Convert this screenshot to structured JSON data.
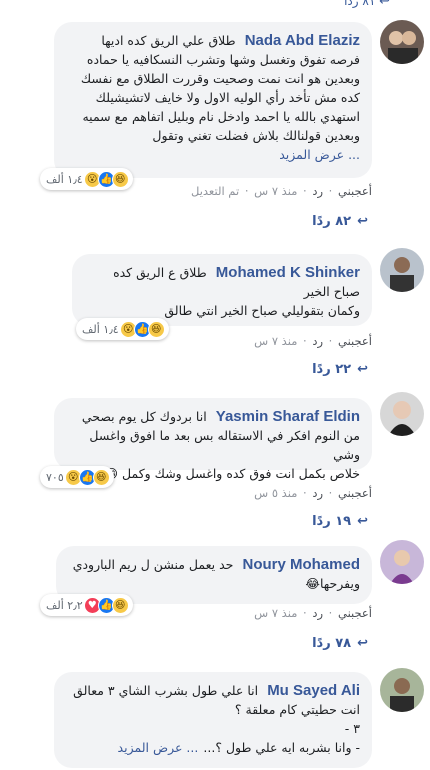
{
  "top": {
    "replies_label": "٨١ ردًا"
  },
  "actions": {
    "like": "أعجبني",
    "reply": "رد",
    "dot": "·",
    "edited": "تم التعديل",
    "more": "... عرض المزيد"
  },
  "comments": [
    {
      "author": "Nada Abd Elaziz",
      "text": "طلاق علي الريق كده اديها\nفرصه تفوق وتغسل وشها وتشرب النسكافيه يا حماده\nوبعدين هو انت نمت وصحيت وقررت الطلاق مع نفسك\nكده مش تأخد رأي الوليه الاول ولا خايف لاتشيشيلك\nاستهدي بالله يا احمد وادخل نام وبليل اتفاهم مع سميه\nوبعدين قولنالك بلاش فضلت تغني وتقول",
      "reactions_count": "١٫٤ ألف",
      "time": "منذ ٧ س",
      "edited": true,
      "replies": "٨٢ ردًا",
      "has_more": true
    },
    {
      "author": "Mohamed K Shinker",
      "text": "طلاق ع الريق كده\nصباح الخير\nوكمان بتقوليلي صباح الخير انتي طالق",
      "reactions_count": "١٫٤ ألف",
      "time": "منذ ٧ س",
      "edited": false,
      "replies": "٢٢ ردًا",
      "has_more": false
    },
    {
      "author": "Yasmin Sharaf Eldin",
      "text": "انا بردوك كل يوم بصحي\nمن النوم افكر في الاستقاله بس بعد ما افوق واغسل وشي\nخلاص بكمل انت فوق كده واغسل وشك وكمل 😁",
      "reactions_count": "٧٠٥",
      "time": "منذ ٥ س",
      "edited": false,
      "replies": "١٩ ردًا",
      "has_more": false
    },
    {
      "author": "Noury Mohamed",
      "text": "حد يعمل منشن ل ريم البارودي\nويفرحها😂",
      "reactions_count": "٢٫٢ ألف",
      "time": "منذ ٧ س",
      "edited": false,
      "replies": "٧٨ ردًا",
      "has_more": false
    },
    {
      "author": "Mu Sayed Ali",
      "text": "انا علي طول بشرب الشاي ٣ معالق\nانت حطيتي كام معلقة ؟\n٣ -\n- وانا بشربه ايه علي طول ؟...",
      "reactions_count": "",
      "time": "",
      "edited": false,
      "replies": "",
      "has_more": true
    }
  ]
}
